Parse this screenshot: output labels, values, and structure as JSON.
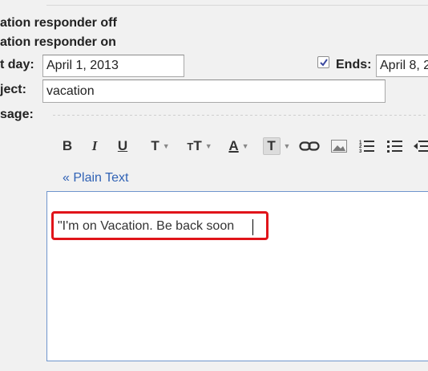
{
  "responder": {
    "off_label": "ation responder off",
    "on_label": "ation responder on"
  },
  "form": {
    "first_day_label": "t day:",
    "first_day_value": "April 1, 2013",
    "ends_label": "Ends:",
    "ends_value": "April 8, 2",
    "ends_checked": true,
    "subject_label": "ject:",
    "subject_value": "vacation",
    "message_label": "sage:"
  },
  "toolbar": {
    "items": [
      "bold-icon",
      "italic-icon",
      "underline-icon",
      "font-icon",
      "font-size-icon",
      "text-color-icon",
      "highlight-icon",
      "link-icon",
      "image-icon",
      "numbered-list-icon",
      "bulleted-list-icon",
      "outdent-icon"
    ]
  },
  "editor": {
    "plain_text_link": "« Plain Text",
    "body": "\"I'm on Vacation. Be back soon",
    "highlight_color": "#e0141a",
    "border_color": "#6f95cd"
  }
}
